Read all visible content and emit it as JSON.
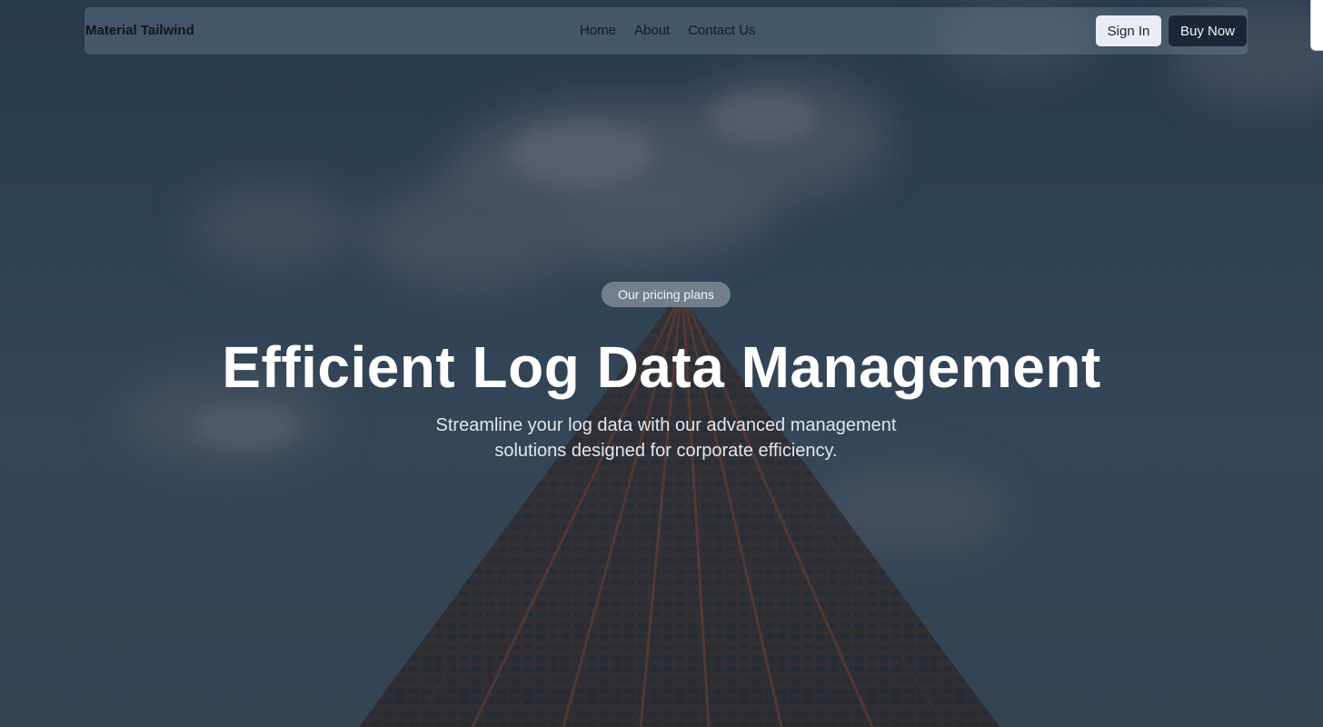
{
  "navbar": {
    "brand": "Material Tailwind",
    "links": [
      "Home",
      "About",
      "Contact Us"
    ],
    "sign_in_label": "Sign In",
    "buy_now_label": "Buy Now"
  },
  "hero": {
    "badge": "Our pricing plans",
    "headline": "Efficient Log Data Management",
    "subtitle": "Streamline your log data with our advanced management solutions designed for corporate efficiency."
  },
  "colors": {
    "sky": "#2b3d52",
    "primary_button": "#1c2638",
    "secondary_button": "#e9edf3",
    "headline_text": "#ffffff"
  }
}
